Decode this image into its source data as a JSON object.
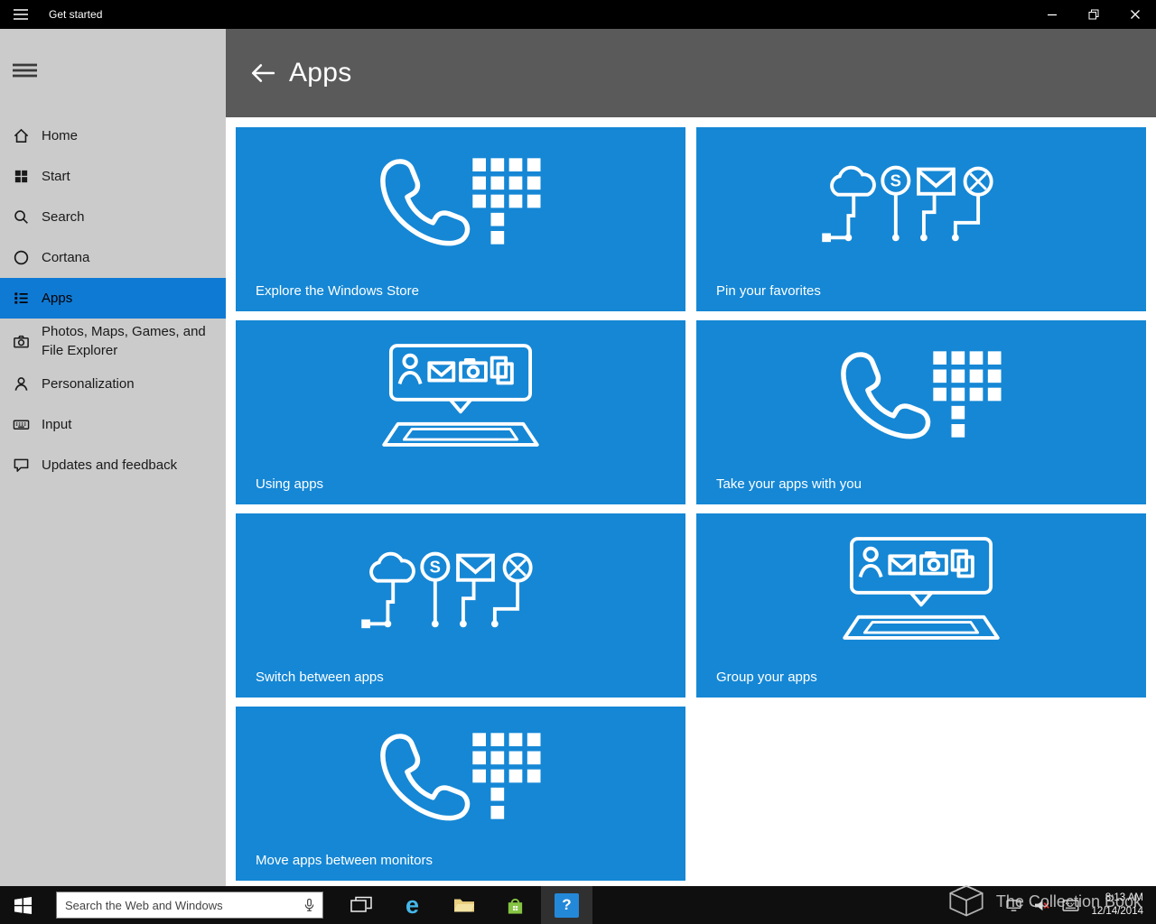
{
  "colors": {
    "accent_blue": "#0f7ad4",
    "tile_blue": "#1587d5",
    "header_gray": "#5a5a5a",
    "sidebar_gray": "#cbcbcb",
    "titlebar_black": "#000000",
    "taskbar_black": "#0f0f0f"
  },
  "titlebar": {
    "title": "Get started"
  },
  "sidebar": {
    "items": [
      {
        "label": "Home",
        "icon": "home-icon",
        "selected": false
      },
      {
        "label": "Start",
        "icon": "start-tiles-icon",
        "selected": false
      },
      {
        "label": "Search",
        "icon": "search-icon",
        "selected": false
      },
      {
        "label": "Cortana",
        "icon": "cortana-circle-icon",
        "selected": false
      },
      {
        "label": "Apps",
        "icon": "apps-list-icon",
        "selected": true
      },
      {
        "label": "Photos, Maps, Games, and File Explorer",
        "icon": "camera-icon",
        "selected": false
      },
      {
        "label": "Personalization",
        "icon": "person-icon",
        "selected": false
      },
      {
        "label": "Input",
        "icon": "keyboard-icon",
        "selected": false
      },
      {
        "label": "Updates and feedback",
        "icon": "feedback-bubble-icon",
        "selected": false
      }
    ]
  },
  "header": {
    "title": "Apps"
  },
  "tiles": [
    {
      "label": "Explore the Windows Store",
      "icon": "phone-dialpad-icon"
    },
    {
      "label": "Pin your favorites",
      "icon": "pinned-favorites-icon"
    },
    {
      "label": "Using apps",
      "icon": "device-apps-bubble-icon"
    },
    {
      "label": "Take your apps with you",
      "icon": "phone-dialpad-icon"
    },
    {
      "label": "Switch between apps",
      "icon": "pinned-favorites-icon"
    },
    {
      "label": "Group your apps",
      "icon": "device-apps-bubble-icon"
    },
    {
      "label": "Move apps between monitors",
      "icon": "phone-dialpad-icon"
    }
  ],
  "taskbar": {
    "search": {
      "placeholder": "Search the Web and Windows"
    },
    "clock": {
      "time": "8:13 AM",
      "date": "12/14/2014"
    }
  },
  "icons": {
    "skype_glyph": "S",
    "edge_glyph": "e",
    "help_glyph": "?"
  },
  "watermark": {
    "text": "The Collection Book"
  }
}
